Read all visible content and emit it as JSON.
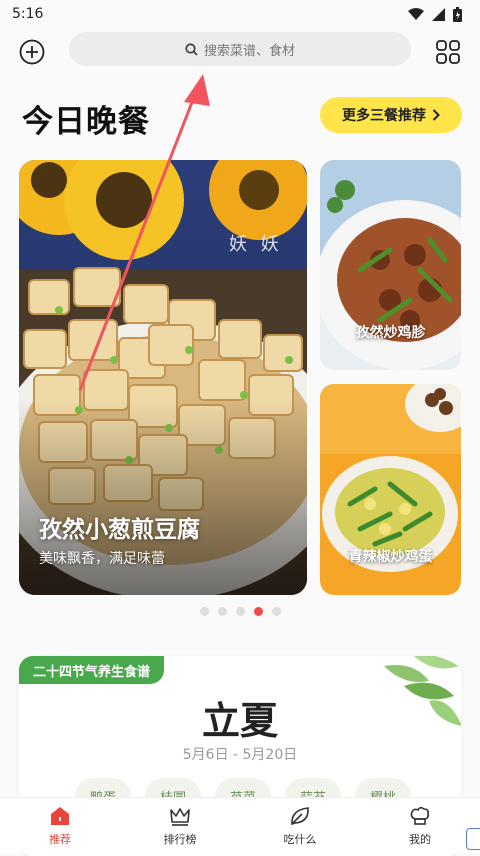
{
  "status_bar": {
    "time": "5:16"
  },
  "header": {
    "search_placeholder": "搜索菜谱、食材"
  },
  "section": {
    "title": "今日晚餐",
    "more_label": "更多三餐推荐"
  },
  "feature": {
    "title": "孜然小葱煎豆腐",
    "subtitle": "美味飘香，满足味蕾",
    "watermark": "妖 妖"
  },
  "side_cards": [
    {
      "title": "孜然炒鸡胗"
    },
    {
      "title": "青辣椒炒鸡蛋"
    }
  ],
  "carousel": {
    "count": 5,
    "active_index": 3
  },
  "solar": {
    "badge": "二十四节气养生食谱",
    "term": "立夏",
    "dates": "5月6日 - 5月20日",
    "chips": [
      "鸭蛋",
      "桂圆",
      "苋菜",
      "蒜苔",
      "樱桃"
    ]
  },
  "tabbar": {
    "items": [
      {
        "label": "推荐",
        "icon": "home-icon",
        "active": true
      },
      {
        "label": "排行榜",
        "icon": "crown-icon",
        "active": false
      },
      {
        "label": "吃什么",
        "icon": "leaf-icon",
        "active": false
      },
      {
        "label": "我的",
        "icon": "chef-hat-icon",
        "active": false
      }
    ]
  },
  "colors": {
    "accent": "#ef4a4a",
    "button_yellow": "#ffe54a",
    "solar_green": "#4aa84c"
  }
}
